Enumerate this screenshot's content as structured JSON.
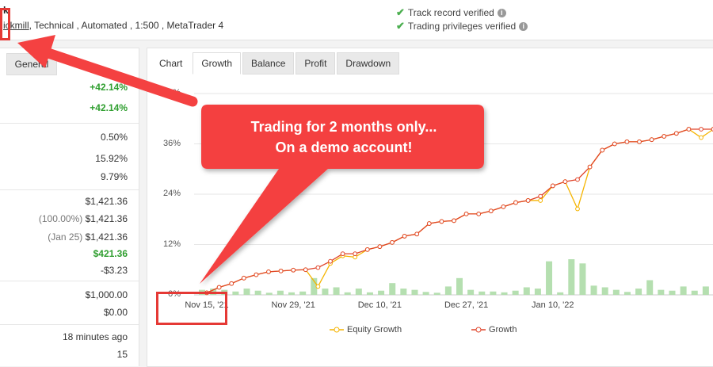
{
  "header": {
    "account_name": "k",
    "meta_prefix": "",
    "broker": "ickmill",
    "meta_rest": ", Technical , Automated , 1:500 , MetaTrader 4",
    "verifications": [
      "Track record verified",
      "Trading privileges verified"
    ]
  },
  "left_panel": {
    "tab_label": "General",
    "stats": [
      {
        "prefix": "",
        "value": "+42.14%",
        "style": "green"
      },
      {
        "prefix": "",
        "value": "+42.14%",
        "style": "green"
      },
      {
        "prefix": "",
        "value": "0.50%",
        "style": ""
      },
      {
        "prefix": "",
        "value": "15.92%",
        "style": ""
      },
      {
        "prefix": "",
        "value": "9.79%",
        "style": ""
      },
      {
        "prefix": "",
        "value": "$1,421.36",
        "style": ""
      },
      {
        "prefix": "(100.00%)",
        "value": "$1,421.36",
        "style": ""
      },
      {
        "prefix": "(Jan 25)",
        "value": "$1,421.36",
        "style": ""
      },
      {
        "prefix": "",
        "value": "$421.36",
        "style": "green"
      },
      {
        "prefix": "",
        "value": "-$3.23",
        "style": ""
      },
      {
        "prefix": "",
        "value": "$1,000.00",
        "style": ""
      },
      {
        "prefix": "",
        "value": "$0.00",
        "style": ""
      },
      {
        "prefix": "",
        "value": "18 minutes ago",
        "style": ""
      },
      {
        "prefix": "",
        "value": "15",
        "style": ""
      }
    ]
  },
  "chart_panel": {
    "tabs": [
      {
        "label": "Chart",
        "state": "plain"
      },
      {
        "label": "Growth",
        "state": "active"
      },
      {
        "label": "Balance",
        "state": ""
      },
      {
        "label": "Profit",
        "state": ""
      },
      {
        "label": "Drawdown",
        "state": ""
      }
    ]
  },
  "chart_data": {
    "type": "line",
    "y_ticks": [
      "0%",
      "12%",
      "24%",
      "36%",
      "48%"
    ],
    "ylim": [
      0,
      48
    ],
    "x_ticks": [
      "Nov 15, '21",
      "Nov 29, '21",
      "Dec 10, '21",
      "Dec 27, '21",
      "Jan 10, '22"
    ],
    "x_tick_index": [
      0,
      7,
      14,
      21,
      28
    ],
    "series": [
      {
        "name": "Equity Growth",
        "color": "#f5b400",
        "values": [
          0.5,
          1.8,
          2.7,
          4.0,
          4.8,
          5.5,
          5.7,
          5.9,
          6.0,
          2.0,
          7.5,
          9.3,
          9.0,
          10.8,
          11.5,
          12.5,
          14.0,
          14.5,
          17.0,
          17.5,
          17.7,
          19.3,
          19.3,
          20.0,
          21.0,
          22.0,
          22.5,
          22.5,
          26.0,
          27.0,
          20.5,
          30.5,
          34.5,
          36.0,
          36.5,
          36.5,
          37.0,
          37.8,
          38.5,
          39.5,
          37.5,
          39.5,
          39.5,
          36.8
        ]
      },
      {
        "name": "Growth",
        "color": "#e0442a",
        "values": [
          0.5,
          1.8,
          2.7,
          4.0,
          4.8,
          5.5,
          5.7,
          5.9,
          6.0,
          6.5,
          8.0,
          9.8,
          9.8,
          10.8,
          11.5,
          12.5,
          14.0,
          14.5,
          17.0,
          17.5,
          17.7,
          19.3,
          19.3,
          20.0,
          21.0,
          22.0,
          22.5,
          23.5,
          26.0,
          27.0,
          27.5,
          30.5,
          34.5,
          36.0,
          36.5,
          36.5,
          37.0,
          37.8,
          38.5,
          39.5,
          39.5,
          39.5,
          39.5,
          39.5
        ]
      }
    ],
    "bars": [
      1.2,
      1.5,
      1.2,
      0.8,
      1.5,
      1.0,
      0.5,
      1.0,
      0.6,
      0.8,
      4.0,
      1.5,
      1.8,
      0.6,
      1.5,
      0.6,
      1.0,
      2.8,
      1.5,
      1.2,
      0.7,
      0.5,
      2.0,
      4.0,
      1.2,
      0.8,
      0.8,
      0.6,
      1.0,
      1.8,
      1.5,
      8.0,
      0.6,
      8.5,
      7.5,
      2.2,
      1.8,
      1.2,
      0.7,
      1.5,
      3.5,
      1.2,
      1.0,
      2.0,
      1.0,
      2.0
    ]
  },
  "annotation": {
    "line1": "Trading for 2 months only...",
    "line2": "On a demo account!",
    "color": "#f44141"
  }
}
